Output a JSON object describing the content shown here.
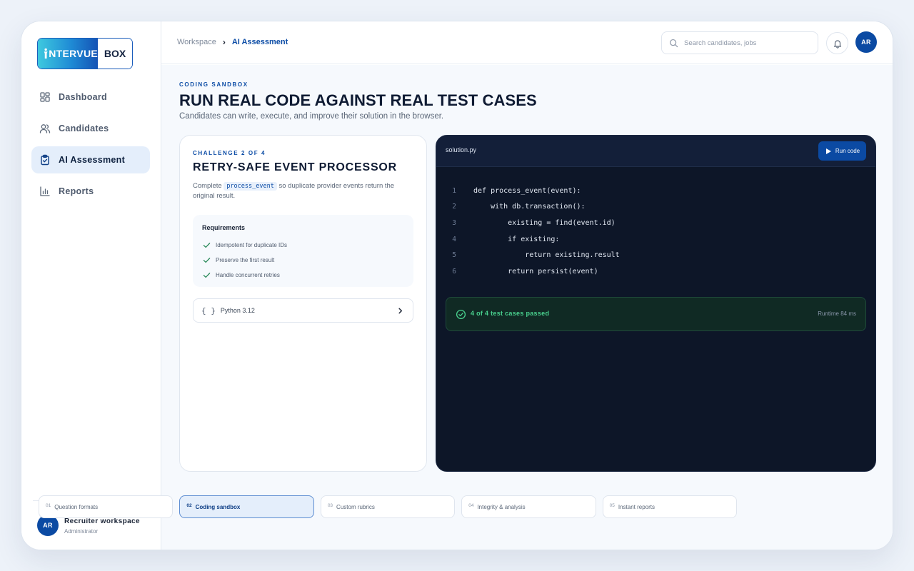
{
  "logo": {
    "left": "NTERVUE",
    "right": "BOX"
  },
  "sidebar": {
    "items": [
      {
        "label": "Dashboard",
        "icon": "grid-icon"
      },
      {
        "label": "Candidates",
        "icon": "users-icon"
      },
      {
        "label": "AI Assessment",
        "icon": "clipboard-check-icon",
        "active": true
      },
      {
        "label": "Reports",
        "icon": "bar-chart-icon"
      }
    ],
    "user": {
      "initials": "AR",
      "name": "Recruiter workspace",
      "role": "Administrator"
    }
  },
  "topbar": {
    "breadcrumb": {
      "root": "Workspace",
      "current": "AI Assessment"
    },
    "search_placeholder": "Search candidates, jobs",
    "avatar_initials": "AR"
  },
  "page": {
    "eyebrow": "CODING SANDBOX",
    "title": "RUN REAL CODE AGAINST REAL TEST CASES",
    "subtitle": "Candidates can write, execute, and improve their solution in the browser."
  },
  "challenge": {
    "eyebrow": "CHALLENGE 2 OF 4",
    "title": "RETRY-SAFE EVENT PROCESSOR",
    "desc_prefix": "Complete",
    "desc_code": "process_event",
    "desc_suffix": "so duplicate provider events return the original result.",
    "requirements_title": "Requirements",
    "requirements": [
      "Idempotent for duplicate IDs",
      "Preserve the first result",
      "Handle concurrent retries"
    ],
    "language": {
      "icon_text": "{ }",
      "label": "Python 3.12"
    }
  },
  "editor": {
    "filename": "solution.py",
    "run_label": "Run code",
    "lines": [
      {
        "n": "1",
        "code": "def process_event(event):"
      },
      {
        "n": "2",
        "code": "    with db.transaction():"
      },
      {
        "n": "3",
        "code": "        existing = find(event.id)"
      },
      {
        "n": "4",
        "code": "        if existing:"
      },
      {
        "n": "5",
        "code": "            return existing.result"
      },
      {
        "n": "6",
        "code": "        return persist(event)"
      }
    ],
    "result": {
      "text": "4 of 4 test cases passed",
      "runtime": "Runtime 84 ms"
    }
  },
  "steps": [
    {
      "num": "01",
      "label": "Question formats"
    },
    {
      "num": "02",
      "label": "Coding sandbox",
      "active": true
    },
    {
      "num": "03",
      "label": "Custom rubrics"
    },
    {
      "num": "04",
      "label": "Integrity & analysis"
    },
    {
      "num": "05",
      "label": "Instant reports"
    }
  ],
  "colors": {
    "accent": "#0b4aa3",
    "editor_bg": "#0d1628",
    "success": "#49d18e",
    "active_nav_bg": "#e4eefb"
  }
}
